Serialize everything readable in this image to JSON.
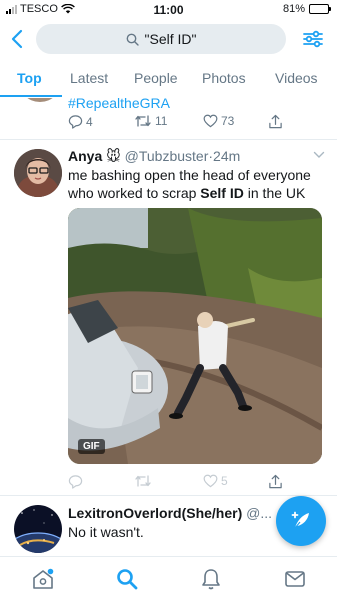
{
  "status_bar": {
    "carrier": "TESCO",
    "time": "11:00",
    "battery": "81%",
    "battery_level": 0.81,
    "icons": [
      "signal-icon",
      "wifi-icon",
      "battery-icon"
    ]
  },
  "search": {
    "query": "\"Self ID\"",
    "icons": [
      "back-icon",
      "search-icon",
      "filter-icon"
    ]
  },
  "tabs": [
    {
      "label": "Top",
      "active": true
    },
    {
      "label": "Latest",
      "active": false
    },
    {
      "label": "People",
      "active": false
    },
    {
      "label": "Photos",
      "active": false
    },
    {
      "label": "Videos",
      "active": false
    }
  ],
  "previous_tweet": {
    "hashtag": "#RepealtheGRA",
    "replies": "4",
    "retweets": "11",
    "likes": "73"
  },
  "tweet": {
    "name": "Anya 🐭",
    "handle": "@Tubzbuster",
    "separator": "·",
    "time": "24m",
    "text_before": "me bashing open the head of everyone who worked to scrap ",
    "text_bold": "Self ID",
    "text_after": " in the UK",
    "media_badge": "GIF",
    "replies": "",
    "retweets": "",
    "likes": "5"
  },
  "tweet2": {
    "name": "LexitronOverlord(She/her)",
    "handle": "@...",
    "text": "No it wasn't."
  },
  "bottom_nav": [
    "home-icon",
    "search-icon",
    "notifications-icon",
    "messages-icon"
  ],
  "colors": {
    "accent": "#1da1f2",
    "muted": "#657786",
    "search_bg": "#e6ecf0"
  }
}
